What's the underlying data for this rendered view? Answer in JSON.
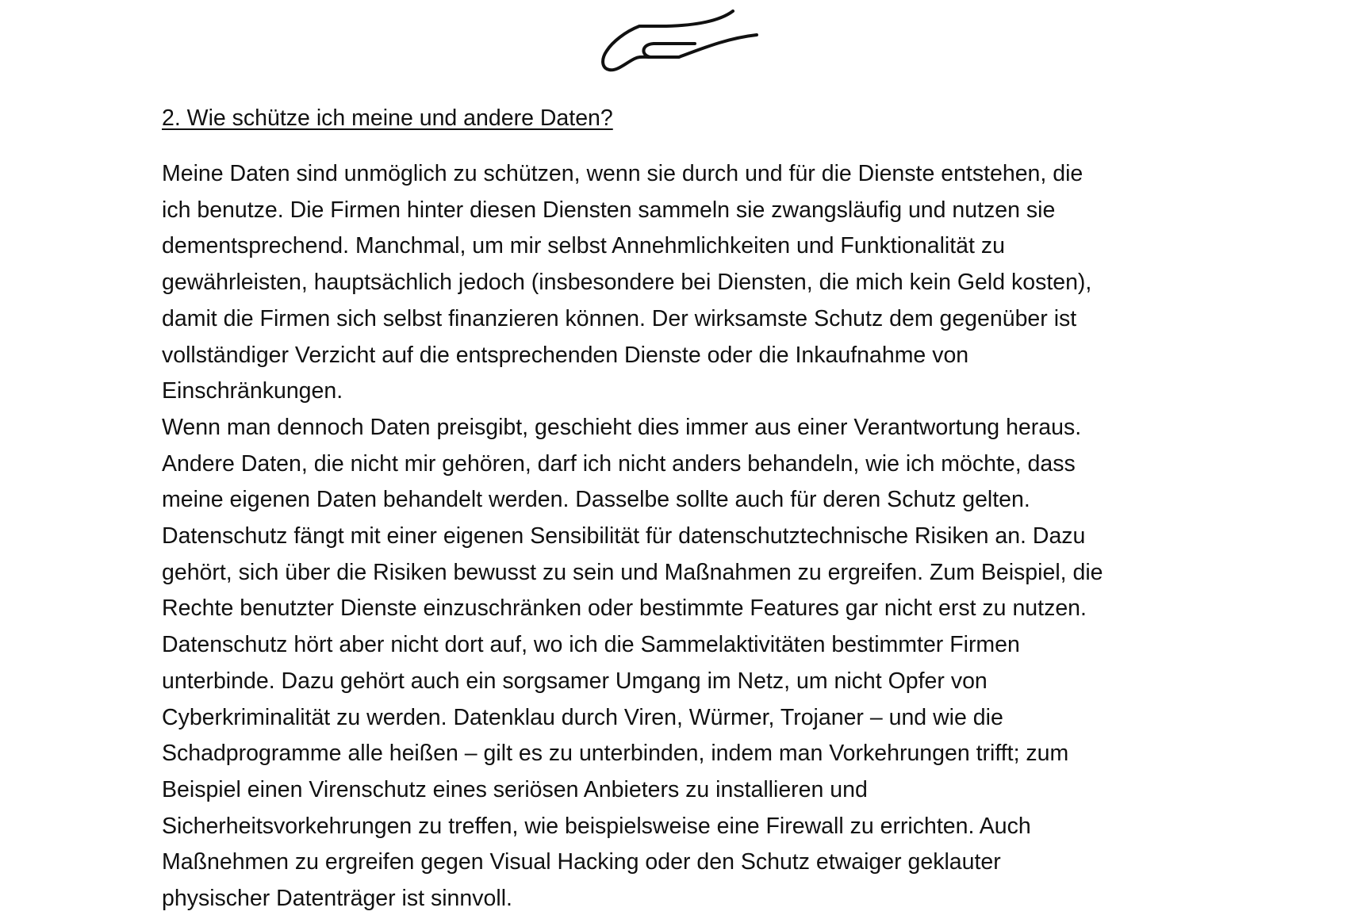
{
  "document": {
    "heading": "2. Wie schütze ich meine und andere Daten?",
    "icon": "hand-icon",
    "lines": [
      "Meine Daten sind unmöglich zu schützen, wenn sie durch und für die Dienste entstehen, die",
      "ich benutze. Die Firmen hinter diesen Diensten sammeln sie zwangsläufig und nutzen sie",
      "dementsprechend. Manchmal, um mir selbst Annehmlichkeiten und Funktionalität zu",
      "gewährleisten, hauptsächlich jedoch (insbesondere bei Diensten, die mich kein Geld kosten),",
      "damit die Firmen sich selbst finanzieren können. Der wirksamste Schutz dem gegenüber ist",
      "vollständiger Verzicht auf die entsprechenden Dienste oder die Inkaufnahme von",
      "Einschränkungen.",
      "Wenn man dennoch Daten preisgibt, geschieht dies immer aus einer Verantwortung heraus.",
      "Andere Daten, die nicht mir gehören, darf ich nicht anders behandeln, wie ich möchte, dass",
      "meine eigenen Daten behandelt werden. Dasselbe sollte auch für deren Schutz gelten.",
      "Datenschutz fängt mit einer eigenen Sensibilität für datenschutztechnische Risiken an. Dazu",
      "gehört, sich über die Risiken bewusst zu sein und Maßnahmen zu ergreifen. Zum Beispiel, die",
      "Rechte benutzter Dienste einzuschränken oder bestimmte Features gar nicht erst zu nutzen.",
      "Datenschutz hört aber nicht dort auf, wo ich die Sammelaktivitäten bestimmter Firmen",
      "unterbinde. Dazu gehört auch ein sorgsamer Umgang im Netz, um nicht Opfer von",
      "Cyberkriminalität zu werden. Datenklau durch Viren, Würmer, Trojaner – und wie die",
      "Schadprogramme alle heißen – gilt es zu unterbinden, indem man Vorkehrungen trifft; zum",
      "Beispiel einen Virenschutz eines seriösen Anbieters zu installieren und",
      "Sicherheitsvorkehrungen zu treffen, wie beispielsweise eine Firewall zu errichten. Auch",
      "Maßnehmen zu ergreifen gegen Visual Hacking oder den Schutz etwaiger geklauter",
      "physischer Datenträger ist sinnvoll."
    ]
  }
}
